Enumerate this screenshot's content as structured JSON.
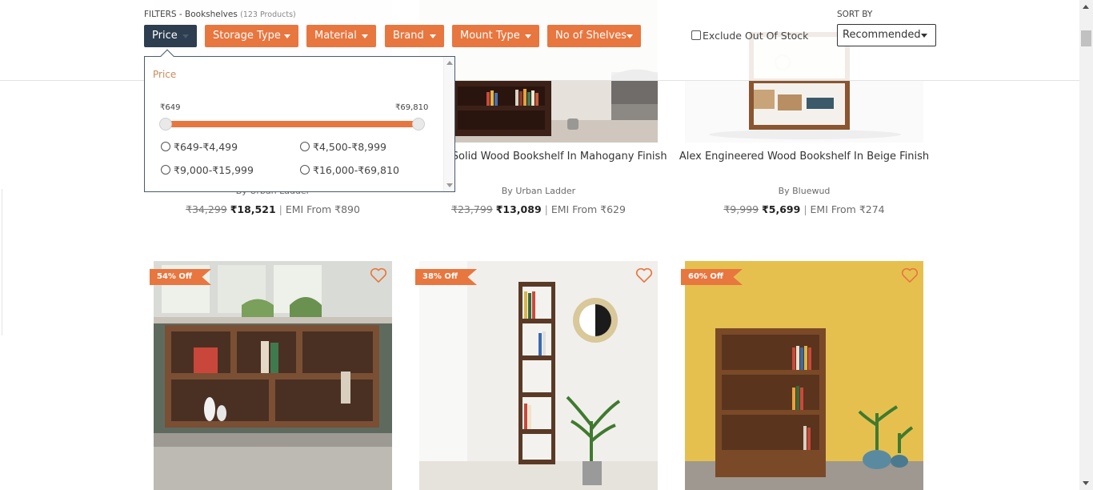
{
  "filters": {
    "prefix": "FILTERS - Bookshelves",
    "count": "(123 Products)",
    "chips": [
      "Price",
      "Storage Type",
      "Material",
      "Brand",
      "Mount Type",
      "No of Shelves"
    ],
    "exclude_oos": "Exclude Out Of Stock"
  },
  "sort": {
    "label": "SORT BY",
    "value": "Recommended"
  },
  "price_dropdown": {
    "title": "Price",
    "min_label": "₹649",
    "max_label": "₹69,810",
    "options": [
      "₹649-₹4,499",
      "₹4,500-₹8,999",
      "₹9,000-₹15,999",
      "₹16,000-₹69,810"
    ]
  },
  "products_row1": [
    {
      "title": "",
      "brand": "By Urban Ladder",
      "mrp": "₹34,299",
      "price": "₹18,521",
      "emi": "EMI From ₹890"
    },
    {
      "title": "Rhodes Solid Wood Bookshelf In Mahogany Finish",
      "brand": "By Urban Ladder",
      "mrp": "₹23,799",
      "price": "₹13,089",
      "emi": "EMI From ₹629"
    },
    {
      "title": "Alex Engineered Wood Bookshelf In Beige Finish",
      "brand": "By Bluewud",
      "mrp": "₹9,999",
      "price": "₹5,699",
      "emi": "EMI From ₹274"
    }
  ],
  "products_row2": [
    {
      "badge": "54% Off"
    },
    {
      "badge": "38% Off"
    },
    {
      "badge": "60% Off"
    }
  ],
  "colors": {
    "accent": "#e8763f",
    "active_chip": "#2c3e50"
  },
  "icons": [
    "heart-icon",
    "caret-down-icon",
    "checkbox-icon",
    "radio-icon"
  ]
}
